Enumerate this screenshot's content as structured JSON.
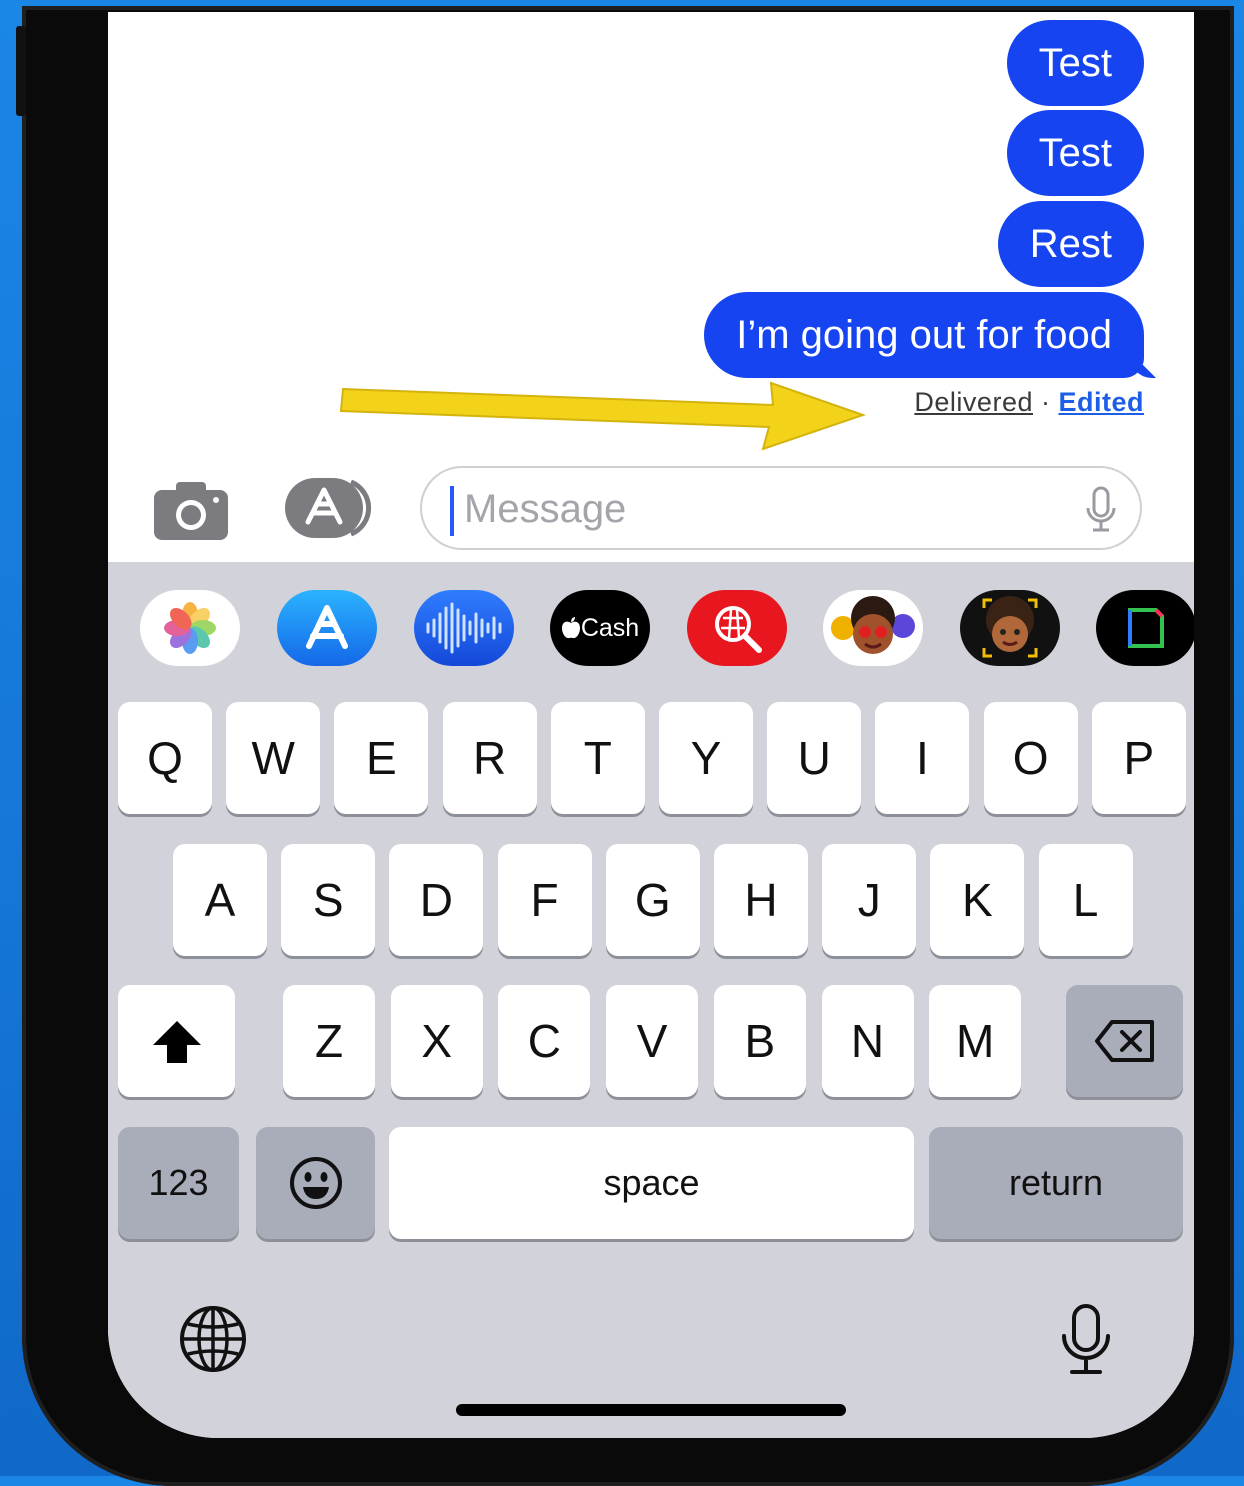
{
  "messages": [
    {
      "text": "Test"
    },
    {
      "text": "Test"
    },
    {
      "text": "Rest"
    },
    {
      "text": "I’m going out for food"
    }
  ],
  "status": {
    "delivered": "Delivered",
    "separator": "·",
    "edited": "Edited"
  },
  "composer": {
    "placeholder": "Message"
  },
  "app_strip": [
    {
      "name": "photos",
      "label": ""
    },
    {
      "name": "app-store",
      "label": ""
    },
    {
      "name": "audio",
      "label": ""
    },
    {
      "name": "apple-cash",
      "label": "Cash"
    },
    {
      "name": "images-search",
      "label": ""
    },
    {
      "name": "memoji-stickers",
      "label": ""
    },
    {
      "name": "memoji",
      "label": ""
    },
    {
      "name": "digital-touch",
      "label": ""
    }
  ],
  "keyboard": {
    "row1": [
      "Q",
      "W",
      "E",
      "R",
      "T",
      "Y",
      "U",
      "I",
      "O",
      "P"
    ],
    "row2": [
      "A",
      "S",
      "D",
      "F",
      "G",
      "H",
      "J",
      "K",
      "L"
    ],
    "row3": [
      "Z",
      "X",
      "C",
      "V",
      "B",
      "N",
      "M"
    ],
    "numbers": "123",
    "space": "space",
    "return": "return"
  },
  "colors": {
    "bubble": "#1644f0",
    "edited": "#1d5ee8",
    "arrow": "#f2d31a",
    "keyboard_bg": "#d2d3da"
  }
}
